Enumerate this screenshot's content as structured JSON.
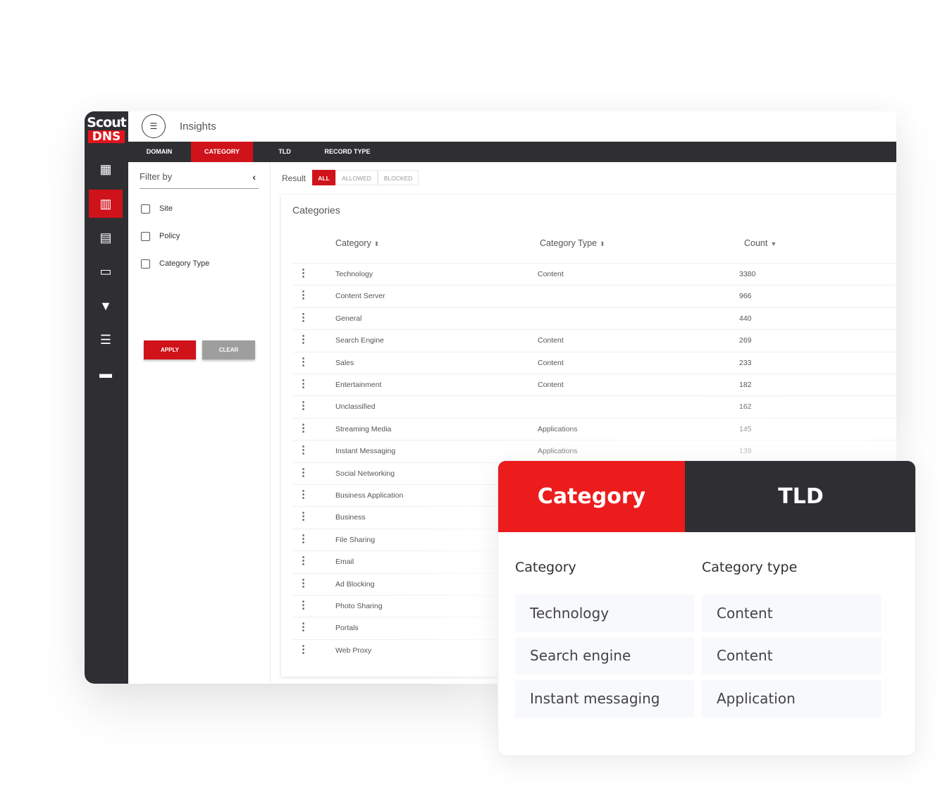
{
  "logo": {
    "line1": "Scout",
    "line2": "DNS"
  },
  "header": {
    "title": "Insights",
    "menu_icon": "list-icon"
  },
  "rail": [
    {
      "name": "rail-dashboard",
      "icon": "dashboard-icon",
      "glyph": "▦",
      "active": false
    },
    {
      "name": "rail-insights",
      "icon": "bar-chart-icon",
      "glyph": "▥",
      "active": true
    },
    {
      "name": "rail-sites",
      "icon": "building-icon",
      "glyph": "▤",
      "active": false
    },
    {
      "name": "rail-devices",
      "icon": "devices-icon",
      "glyph": "▭",
      "active": false
    },
    {
      "name": "rail-filters",
      "icon": "filter-icon",
      "glyph": "▼",
      "active": false
    },
    {
      "name": "rail-reports",
      "icon": "clipboard-icon",
      "glyph": "☰",
      "active": false
    },
    {
      "name": "rail-docs",
      "icon": "book-icon",
      "glyph": "▬",
      "active": false
    }
  ],
  "tabs": [
    {
      "label": "DOMAIN",
      "active": false
    },
    {
      "label": "CATEGORY",
      "active": true
    },
    {
      "label": "TLD",
      "active": false
    },
    {
      "label": "RECORD TYPE",
      "active": false
    }
  ],
  "filter": {
    "title": "Filter by",
    "options": [
      "Site",
      "Policy",
      "Category Type"
    ],
    "apply": "APPLY",
    "clear": "CLEAR",
    "apply_color": "#d0121a",
    "clear_color": "#9e9e9e"
  },
  "result": {
    "label": "Result",
    "options": [
      {
        "label": "ALL",
        "active": true
      },
      {
        "label": "ALLOWED",
        "active": false
      },
      {
        "label": "BLOCKED",
        "active": false
      }
    ]
  },
  "table": {
    "title": "Categories",
    "columns": [
      "Category",
      "Category Type",
      "Count"
    ],
    "rows": [
      {
        "category": "Technology",
        "type": "Content",
        "count": "3380"
      },
      {
        "category": "Content Server",
        "type": "",
        "count": "966"
      },
      {
        "category": "General",
        "type": "",
        "count": "440"
      },
      {
        "category": "Search Engine",
        "type": "Content",
        "count": "269"
      },
      {
        "category": "Sales",
        "type": "Content",
        "count": "233"
      },
      {
        "category": "Entertainment",
        "type": "Content",
        "count": "182"
      },
      {
        "category": "Unclassified",
        "type": "",
        "count": "162"
      },
      {
        "category": "Streaming Media",
        "type": "Applications",
        "count": "145"
      },
      {
        "category": "Instant Messaging",
        "type": "Applications",
        "count": "139"
      },
      {
        "category": "Social Networking",
        "type": "",
        "count": ""
      },
      {
        "category": "Business Application",
        "type": "",
        "count": ""
      },
      {
        "category": "Business",
        "type": "",
        "count": ""
      },
      {
        "category": "File Sharing",
        "type": "",
        "count": ""
      },
      {
        "category": "Email",
        "type": "",
        "count": ""
      },
      {
        "category": "Ad Blocking",
        "type": "",
        "count": ""
      },
      {
        "category": "Photo Sharing",
        "type": "",
        "count": ""
      },
      {
        "category": "Portals",
        "type": "",
        "count": ""
      },
      {
        "category": "Web Proxy",
        "type": "",
        "count": ""
      }
    ]
  },
  "overlay": {
    "tabs": [
      {
        "label": "Category",
        "active": true
      },
      {
        "label": "TLD",
        "active": false
      }
    ],
    "headers": [
      "Category",
      "Category type"
    ],
    "rows": [
      {
        "category": "Technology",
        "type": "Content"
      },
      {
        "category": "Search engine",
        "type": "Content"
      },
      {
        "category": "Instant messaging",
        "type": "Application"
      }
    ]
  },
  "colors": {
    "accent": "#d0121a",
    "overlay_accent": "#ec1c1c",
    "dark": "#2f2f33"
  }
}
